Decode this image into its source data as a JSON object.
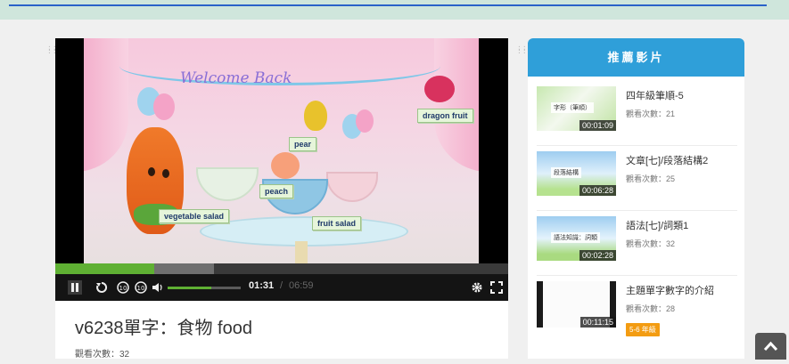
{
  "video": {
    "title": "v6238單字：食物 food",
    "views": "觀看次數：32",
    "current_time": "01:31",
    "separator": "/",
    "duration": "06:59",
    "progress_fraction": 0.218,
    "buffer_fraction": 0.35,
    "volume_fraction": 0.6,
    "scene": {
      "welcome_text": "Welcome Back",
      "labels": {
        "dragon_fruit": "dragon fruit",
        "pear": "pear",
        "peach": "peach",
        "vegetable_salad": "vegetable salad",
        "fruit_salad": "fruit salad"
      }
    },
    "controls": {
      "pause": "pause-icon",
      "replay": "replay-icon",
      "rewind": "rewind-10-icon",
      "forward": "forward-10-icon",
      "volume": "volume-icon",
      "settings": "gear-icon",
      "fullscreen": "fullscreen-icon"
    },
    "accent_color": "#5fb033"
  },
  "sidebar": {
    "heading": "推薦影片",
    "header_color": "#2f9fd9",
    "items": [
      {
        "title": "四年級筆順-5",
        "views": "觀看次數：21",
        "duration": "00:01:09",
        "thumb_caption": "字形（筆順）"
      },
      {
        "title": "文章[七]/段落結構2",
        "views": "觀看次數：25",
        "duration": "00:06:28",
        "thumb_caption": "段落結構"
      },
      {
        "title": "語法[七]/詞類1",
        "views": "觀看次數：32",
        "duration": "00:02:28",
        "thumb_caption": "語法知識：詞類"
      },
      {
        "title": "主題單字數字的介紹",
        "views": "觀看次數：28",
        "duration": "00:11:15",
        "badge": "5-6 年級",
        "badge_color": "#f39c12"
      }
    ]
  }
}
